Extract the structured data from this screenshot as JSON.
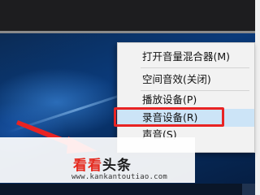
{
  "context_menu": {
    "items": [
      {
        "label": "打开音量混合器(M)"
      },
      {
        "label": "空间音效(关闭)"
      },
      {
        "label": "播放设备(P)"
      },
      {
        "label": "录音设备(R)"
      },
      {
        "label": "声音(S)"
      }
    ],
    "highlighted_label": "录音设备(R)"
  },
  "watermark": {
    "brand_part1": "看看",
    "brand_part2": "头条",
    "url": "www.kankantoutiao.com"
  },
  "colors": {
    "highlight_box": "#e82323",
    "menu_hover": "#cce4f7",
    "desktop": "#0a3a7a",
    "brand_red": "#e52b20"
  }
}
